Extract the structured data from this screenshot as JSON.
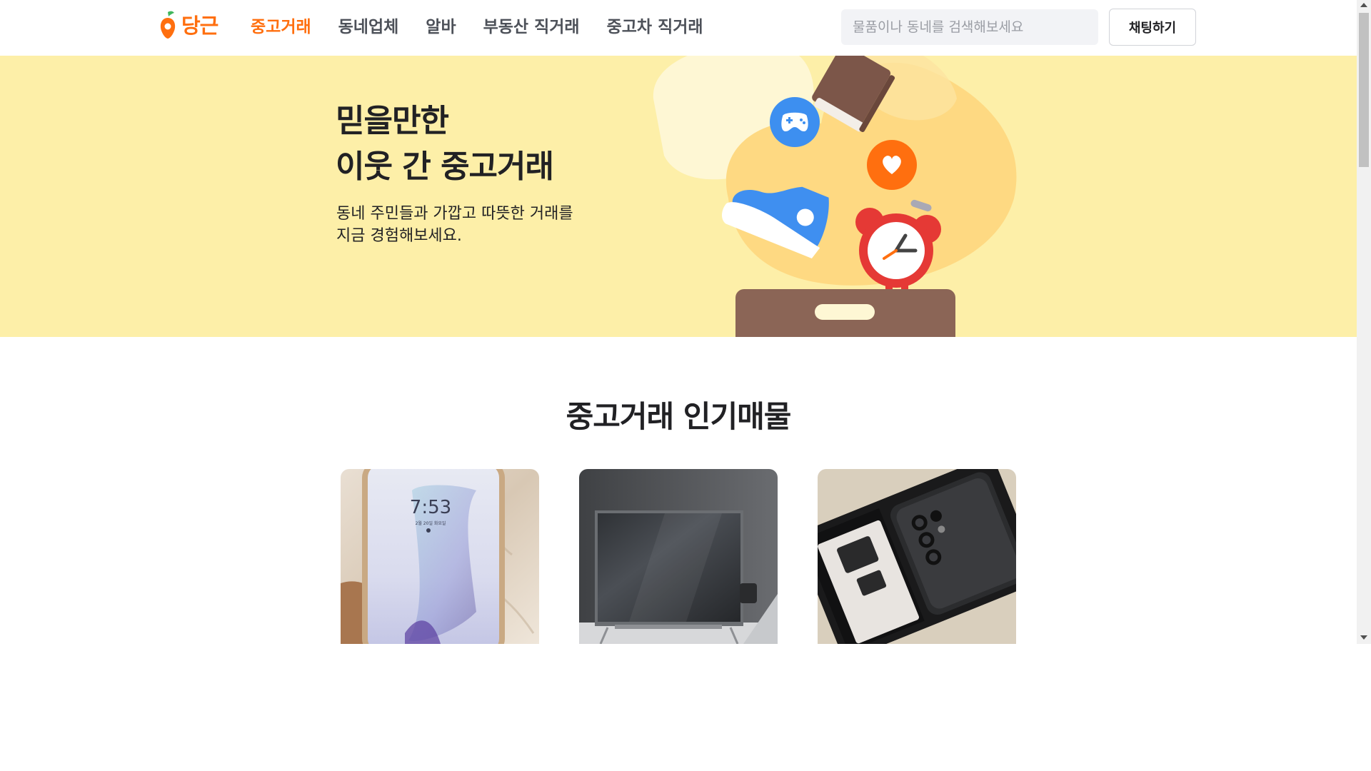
{
  "header": {
    "logo_text": "당근",
    "nav": [
      {
        "label": "중고거래",
        "active": true
      },
      {
        "label": "동네업체",
        "active": false
      },
      {
        "label": "알바",
        "active": false
      },
      {
        "label": "부동산 직거래",
        "active": false
      },
      {
        "label": "중고차 직거래",
        "active": false
      }
    ],
    "search_placeholder": "물품이나 동네를 검색해보세요",
    "chat_button": "채팅하기"
  },
  "hero": {
    "title_line1": "믿을만한",
    "title_line2": "이웃 간 중고거래",
    "desc_line1": "동네 주민들과 가깝고 따뜻한 거래를",
    "desc_line2": "지금 경험해보세요."
  },
  "section": {
    "title": "중고거래 인기매물"
  },
  "cards": [
    {
      "image": "smartphone-photo",
      "screen_time": "7:53",
      "screen_date": "2월 20일 화요일"
    },
    {
      "image": "television-photo"
    },
    {
      "image": "galaxy-phone-box-photo"
    }
  ],
  "colors": {
    "brand": "#ff6f0f",
    "hero_bg": "#fdefa8",
    "text": "#212124"
  }
}
